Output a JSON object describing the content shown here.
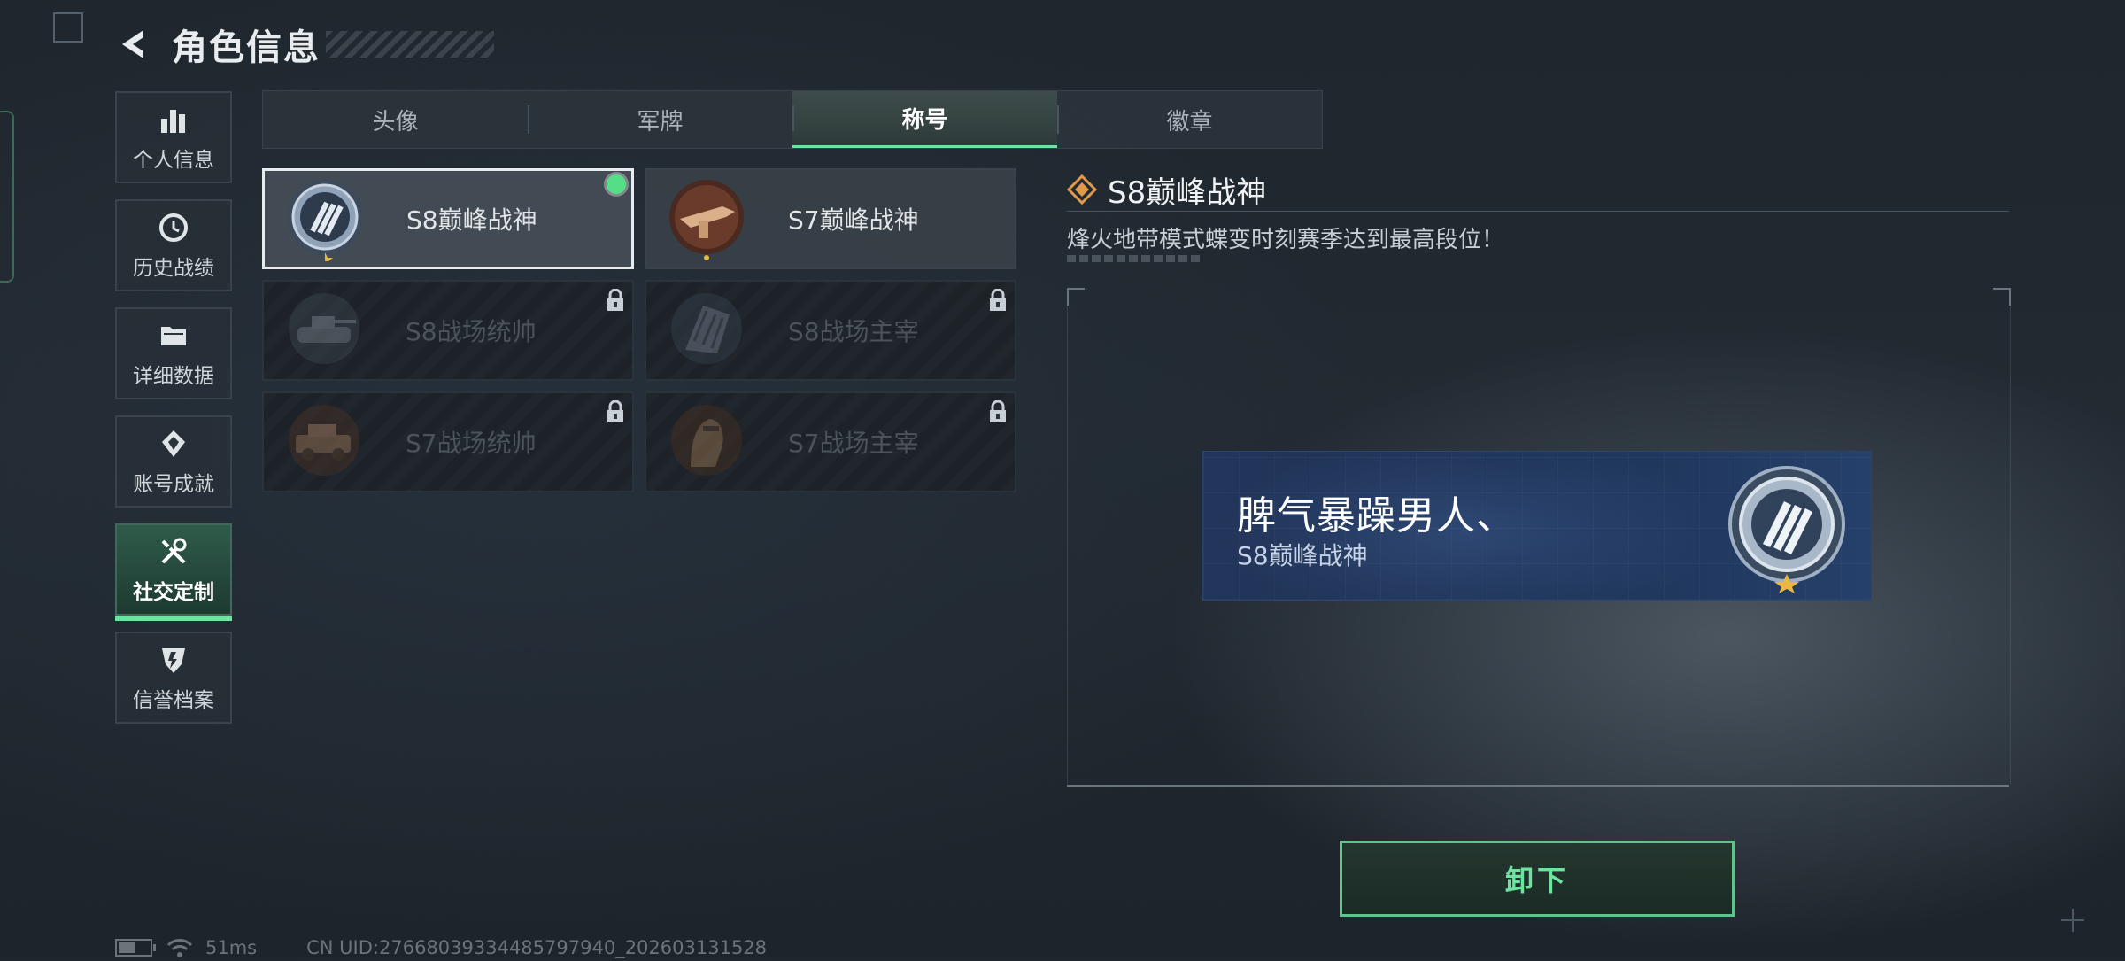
{
  "header": {
    "title": "角色信息"
  },
  "sidebar": {
    "items": [
      {
        "label": "个人信息",
        "icon": "bar-chart-icon"
      },
      {
        "label": "历史战绩",
        "icon": "clock-icon"
      },
      {
        "label": "详细数据",
        "icon": "folder-icon"
      },
      {
        "label": "账号成就",
        "icon": "achievement-icon"
      },
      {
        "label": "社交定制",
        "icon": "tools-icon",
        "active": true
      },
      {
        "label": "信誉档案",
        "icon": "shield-icon"
      }
    ]
  },
  "tabs": [
    {
      "label": "头像"
    },
    {
      "label": "军牌"
    },
    {
      "label": "称号",
      "active": true
    },
    {
      "label": "徽章"
    }
  ],
  "titles": [
    {
      "name": "S8巅峰战神",
      "locked": false,
      "selected": true,
      "equipped": true,
      "medal": "s8-emblem-icon"
    },
    {
      "name": "S7巅峰战神",
      "locked": false,
      "selected": false,
      "equipped": false,
      "medal": "s7-weapon-emblem-icon"
    },
    {
      "name": "S8战场统帅",
      "locked": true,
      "medal": "tank-emblem-icon"
    },
    {
      "name": "S8战场主宰",
      "locked": true,
      "medal": "building-emblem-icon"
    },
    {
      "name": "S7战场统帅",
      "locked": true,
      "medal": "vehicle-emblem-icon"
    },
    {
      "name": "S7战场主宰",
      "locked": true,
      "medal": "soldier-emblem-icon"
    }
  ],
  "detail": {
    "title": "S8巅峰战神",
    "description": "烽火地带模式蝶变时刻赛季达到最高段位！"
  },
  "nameplate": {
    "player_name": "脾气暴躁男人、",
    "title": "S8巅峰战神"
  },
  "actions": {
    "unequip_label": "卸下"
  },
  "status_bar": {
    "ping": "51ms",
    "uid": "CN UID:27668039334485797940_202603131528",
    "battery_level": 0.6
  },
  "colors": {
    "accent": "#6ee3a0",
    "equipped": "#55dd88",
    "nameplate_bg": "#1d3154"
  }
}
